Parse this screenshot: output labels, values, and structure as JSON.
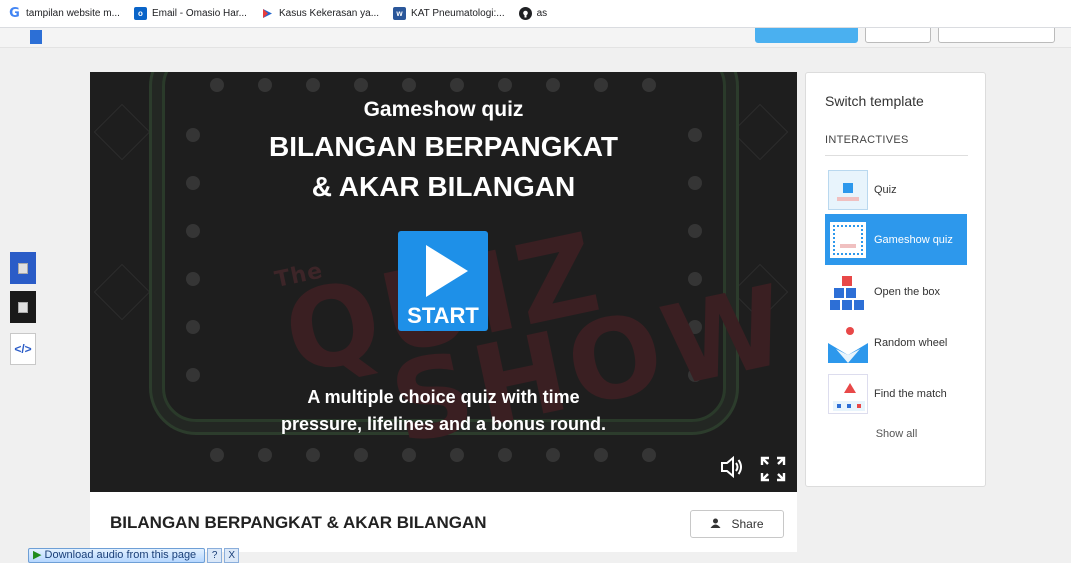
{
  "bookmarks": [
    {
      "icon": "google-icon",
      "label": "tampilan website m..."
    },
    {
      "icon": "outlook-icon",
      "label": "Email - Omasio Har..."
    },
    {
      "icon": "kinemaster-icon",
      "label": "Kasus Kekerasan ya..."
    },
    {
      "icon": "word-icon",
      "label": "KAT Pneumatologi:..."
    },
    {
      "icon": "github-icon",
      "label": "as"
    }
  ],
  "game": {
    "template_label": "Gameshow quiz",
    "title_line1": "BILANGAN BERPANGKAT",
    "title_line2": "& AKAR BILANGAN",
    "start_label": "START",
    "description_line1": "A multiple choice quiz with time",
    "description_line2": "pressure, lifelines and a bonus round.",
    "watermark_top": "The",
    "watermark_word1": "QUIZ",
    "watermark_word2": "SHOW",
    "sound_icon": "speaker-icon",
    "fullscreen_icon": "fullscreen-icon",
    "sound_glyph": "🕩",
    "fullscreen_glyph": "⛶"
  },
  "activity": {
    "title": "BILANGAN BERPANGKAT & AKAR BILANGAN",
    "share_label": "Share"
  },
  "panel": {
    "title": "Switch template",
    "section": "INTERACTIVES",
    "templates": [
      {
        "name": "Quiz",
        "active": false
      },
      {
        "name": "Gameshow quiz",
        "active": true
      },
      {
        "name": "Open the box",
        "active": false
      },
      {
        "name": "Random wheel",
        "active": false
      },
      {
        "name": "Find the match",
        "active": false
      }
    ],
    "show_all": "Show all"
  },
  "tools": {
    "embed_label": "</>"
  },
  "download_bar": {
    "label": "Download audio from this page",
    "help": "?",
    "close": "X"
  },
  "colors": {
    "accent": "#2d98ec",
    "start_button": "#1e90e8",
    "game_bg": "#1e1e1e"
  }
}
